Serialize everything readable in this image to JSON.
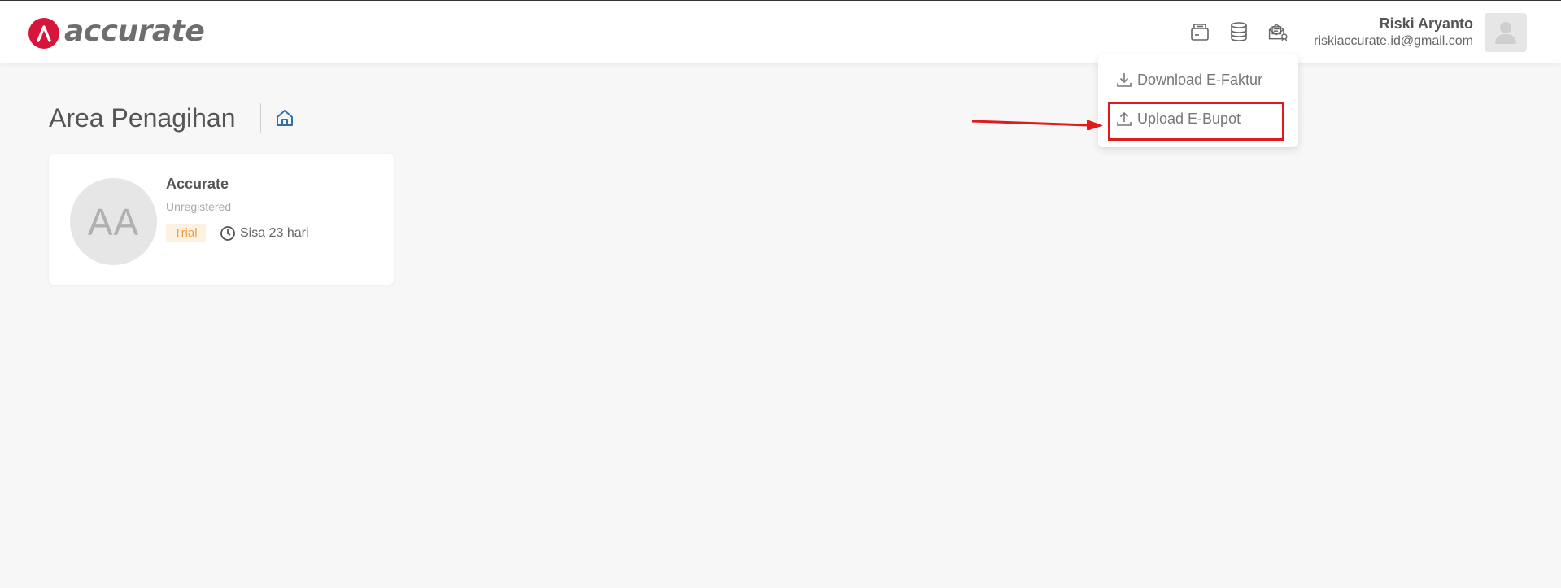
{
  "header": {
    "logo_text": "accurate",
    "brand_color": "#d7143b",
    "icons": [
      "e-faktur-icon",
      "database-icon",
      "tax-document-icon"
    ],
    "user": {
      "name": "Riski Aryanto",
      "email": "riskiaccurate.id@gmail.com"
    }
  },
  "dropdown": {
    "items": [
      {
        "label": "Download E-Faktur",
        "icon": "download-icon"
      },
      {
        "label": "Upload E-Bupot",
        "icon": "upload-icon"
      }
    ],
    "highlight_color": "#e01b1b"
  },
  "page": {
    "title": "Area Penagihan"
  },
  "card": {
    "initials": "AA",
    "company_name": "Accurate",
    "status": "Unregistered",
    "badge": "Trial",
    "remaining": "Sisa 23 hari"
  }
}
